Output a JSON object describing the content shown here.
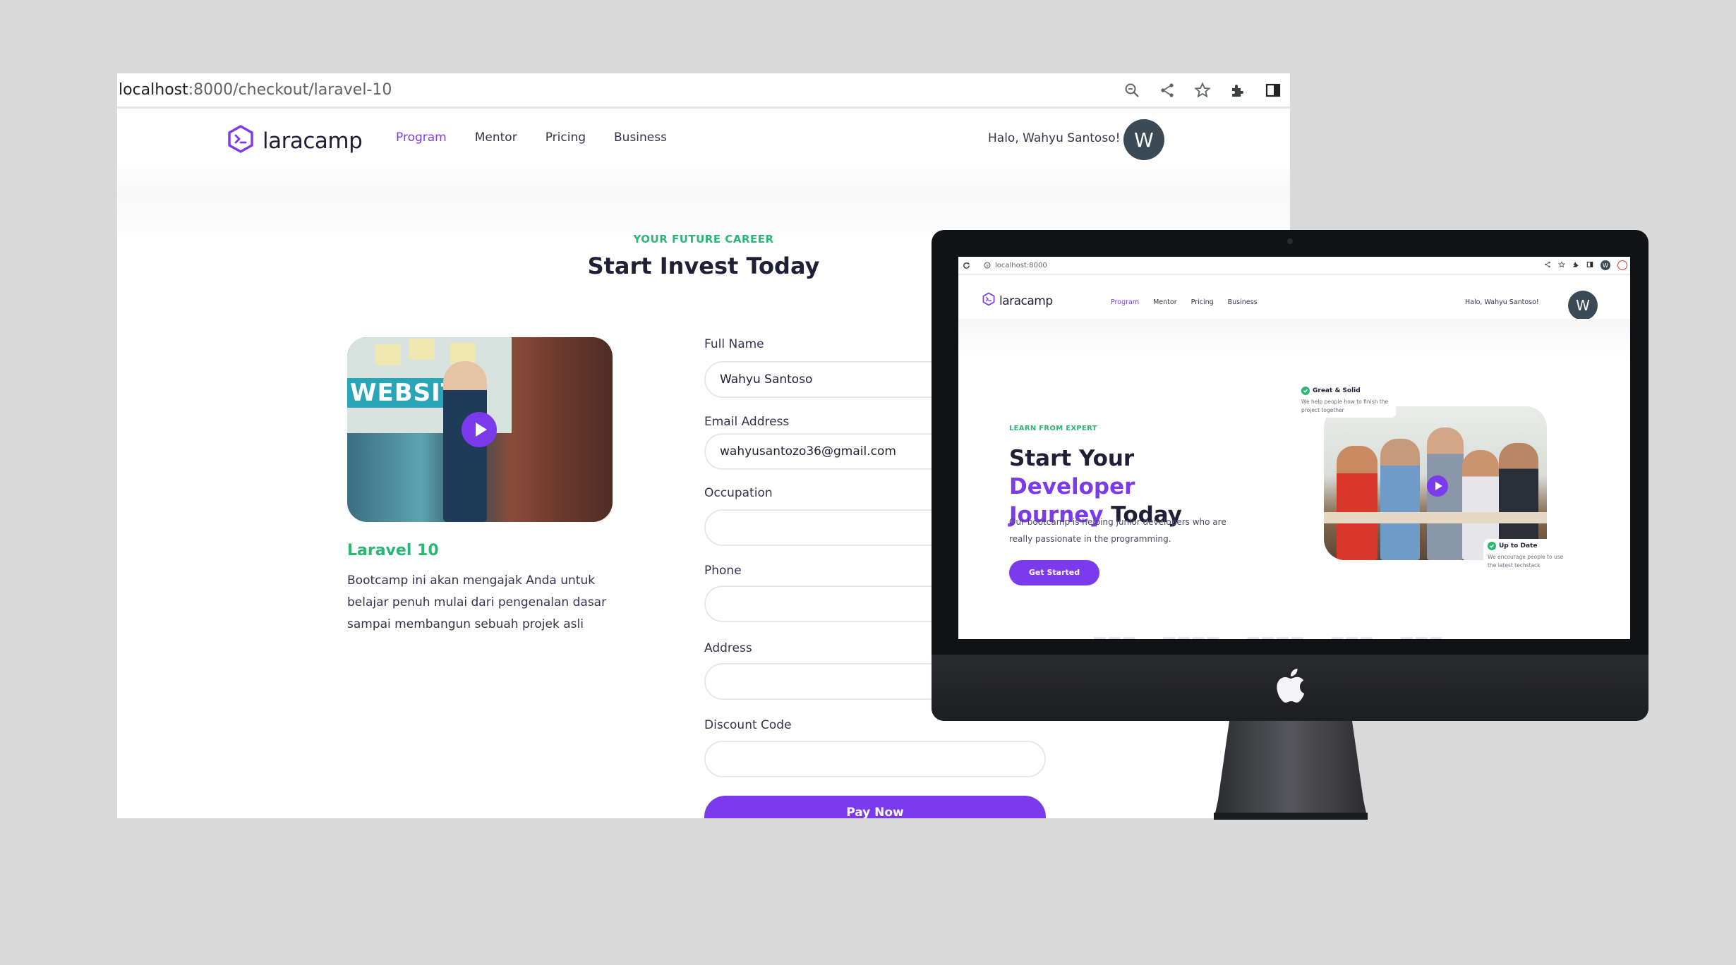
{
  "browser": {
    "url_host": "localhost",
    "url_rest": ":8000/checkout/laravel-10"
  },
  "site": {
    "logo_text": "laracamp",
    "nav": [
      "Program",
      "Mentor",
      "Pricing",
      "Business"
    ],
    "active_nav": "Program",
    "greeting": "Halo, Wahyu Santoso!",
    "avatar_initial": "W"
  },
  "checkout": {
    "eyebrow": "YOUR FUTURE CAREER",
    "title": "Start Invest Today",
    "course": {
      "thumb_banner": "WEBSITE",
      "name": "Laravel 10",
      "description": "Bootcamp ini akan mengajak Anda untuk belajar penuh mulai dari pengenalan dasar sampai membangun sebuah projek asli"
    },
    "form": {
      "full_name_label": "Full Name",
      "full_name_value": "Wahyu Santoso",
      "email_label": "Email Address",
      "email_value": "wahyusantozo36@gmail.com",
      "occupation_label": "Occupation",
      "occupation_value": "",
      "phone_label": "Phone",
      "phone_value": "",
      "address_label": "Address",
      "address_value": "",
      "discount_label": "Discount Code",
      "discount_value": "",
      "submit_label": "Pay Now"
    }
  },
  "imac_screen": {
    "url": "localhost:8000",
    "logo_text": "laracamp",
    "nav": [
      "Program",
      "Mentor",
      "Pricing",
      "Business"
    ],
    "greeting": "Halo, Wahyu Santoso!",
    "avatar_initial": "W",
    "hero": {
      "eyebrow": "LEARN FROM EXPERT",
      "headline_1": "Start Your ",
      "headline_hl1": "Developer",
      "headline_hl2": "Journey",
      "headline_2": " Today",
      "description": "Our bootcamp is helping junior developers who are really passionate in the programming.",
      "cta": "Get Started"
    },
    "card_top": {
      "title": "Great & Solid",
      "text": "We help people how to finish the project together"
    },
    "card_bottom": {
      "title": "Up to Date",
      "text": "We encourage people to use the latest techstack"
    }
  },
  "colors": {
    "accent": "#7c3aed",
    "green": "#2bb673",
    "avatar": "#3b4a54",
    "background": "#d9d9d9"
  },
  "icons": [
    "zoom-icon",
    "share-icon",
    "star-icon",
    "extensions-icon",
    "side-panel-icon",
    "laracamp-logo-icon",
    "play-icon",
    "check-icon",
    "apple-logo-icon",
    "reload-icon",
    "info-icon"
  ]
}
